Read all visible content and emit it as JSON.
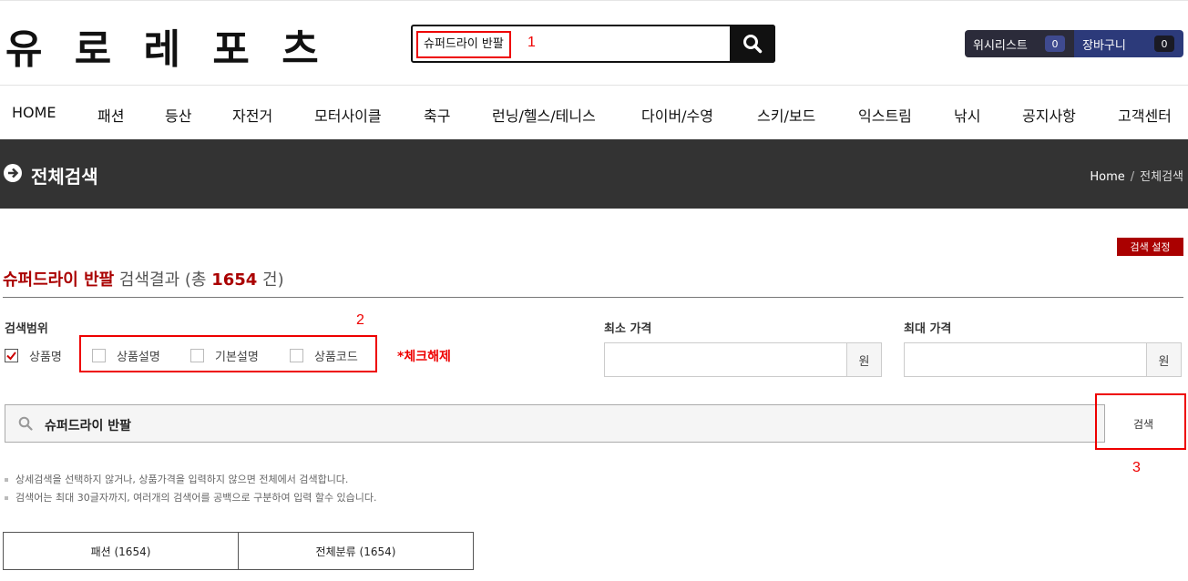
{
  "header": {
    "logo": "유 로 레 포 츠",
    "search_value": "슈퍼드라이 반팔",
    "wishlist_label": "위시리스트",
    "wishlist_count": "0",
    "cart_label": "장바구니",
    "cart_count": "0"
  },
  "annotations": {
    "a1": "1",
    "a2": "2",
    "a3": "3",
    "uncheck_note": "*체크해제"
  },
  "nav": [
    "HOME",
    "패션",
    "등산",
    "자전거",
    "모터사이클",
    "축구",
    "런닝/헬스/테니스",
    "다이버/수영",
    "스키/보드",
    "익스트림",
    "낚시",
    "공지사항",
    "고객센터"
  ],
  "banner": {
    "title": "전체검색",
    "crumb_home": "Home",
    "crumb_sep": "/",
    "crumb_current": "전체검색"
  },
  "settings_button": "검색 설정",
  "result": {
    "keyword": "슈퍼드라이 반팔",
    "label": " 검색결과 (총 ",
    "count": "1654",
    "suffix": " 건)"
  },
  "filters": {
    "scope_label": "검색범위",
    "scope_options": [
      {
        "label": "상품명",
        "checked": true
      },
      {
        "label": "상품설명",
        "checked": false
      },
      {
        "label": "기본설명",
        "checked": false
      },
      {
        "label": "상품코드",
        "checked": false
      }
    ],
    "min_price_label": "최소 가격",
    "max_price_label": "최대 가격",
    "currency_unit": "원"
  },
  "keyword_input": "슈퍼드라이 반팔",
  "search_button": "검색",
  "notes": [
    "상세검색을 선택하지 않거나, 상품가격을 입력하지 않으면 전체에서 검색합니다.",
    "검색어는 최대 30글자까지, 여러개의 검색어를 공백으로 구분하여 입력 할수 있습니다."
  ],
  "categories": [
    "패션 (1654)",
    "전체분류 (1654)"
  ],
  "colors": {
    "accent_red": "#aa0000",
    "banner_bg": "#333333",
    "annotation_red": "#ee0000"
  }
}
